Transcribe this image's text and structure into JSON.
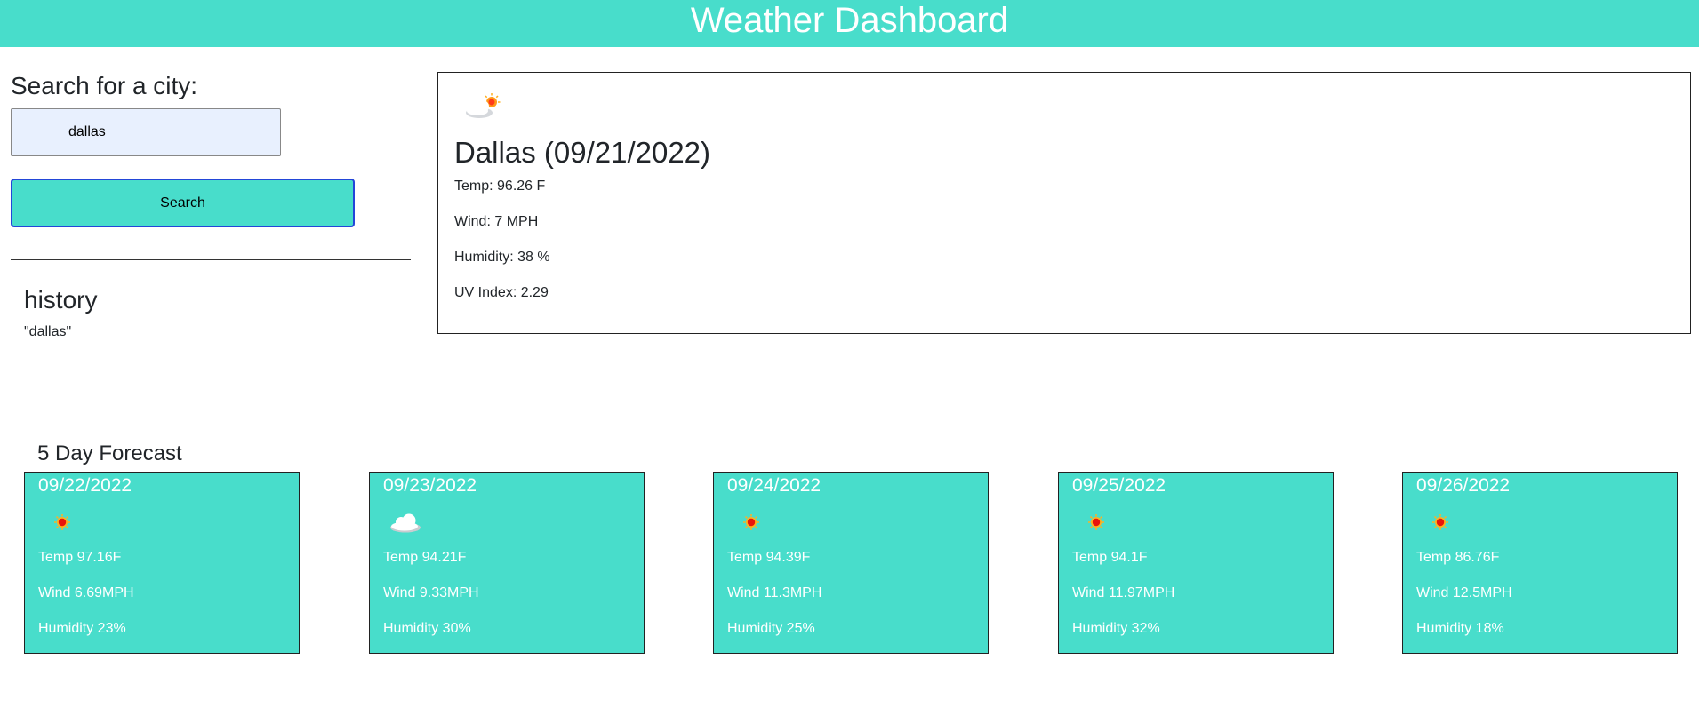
{
  "header": {
    "title": "Weather Dashboard"
  },
  "search": {
    "heading": "Search for a city:",
    "value": "dallas",
    "button_label": "Search"
  },
  "history": {
    "heading": "history",
    "items": [
      "\"dallas\""
    ]
  },
  "current": {
    "icon": "partly-cloudy-icon",
    "title": "Dallas (09/21/2022)",
    "temp": "Temp: 96.26 F",
    "wind": "Wind: 7 MPH",
    "humidity": "Humidity: 38 %",
    "uv": "UV Index: 2.29"
  },
  "forecast": {
    "heading": "5 Day Forecast",
    "days": [
      {
        "date": "09/22/2022",
        "icon": "sun-icon",
        "temp": "Temp 97.16F",
        "wind": "Wind 6.69MPH",
        "humidity": "Humidity 23%"
      },
      {
        "date": "09/23/2022",
        "icon": "cloud-icon",
        "temp": "Temp 94.21F",
        "wind": "Wind 9.33MPH",
        "humidity": "Humidity 30%"
      },
      {
        "date": "09/24/2022",
        "icon": "sun-icon",
        "temp": "Temp 94.39F",
        "wind": "Wind 11.3MPH",
        "humidity": "Humidity 25%"
      },
      {
        "date": "09/25/2022",
        "icon": "sun-icon",
        "temp": "Temp 94.1F",
        "wind": "Wind 11.97MPH",
        "humidity": "Humidity 32%"
      },
      {
        "date": "09/26/2022",
        "icon": "sun-icon",
        "temp": "Temp 86.76F",
        "wind": "Wind 12.5MPH",
        "humidity": "Humidity 18%"
      }
    ]
  },
  "colors": {
    "accent": "#48ddcb",
    "button_border": "#2346d8",
    "input_bg": "#e8f0fe"
  }
}
